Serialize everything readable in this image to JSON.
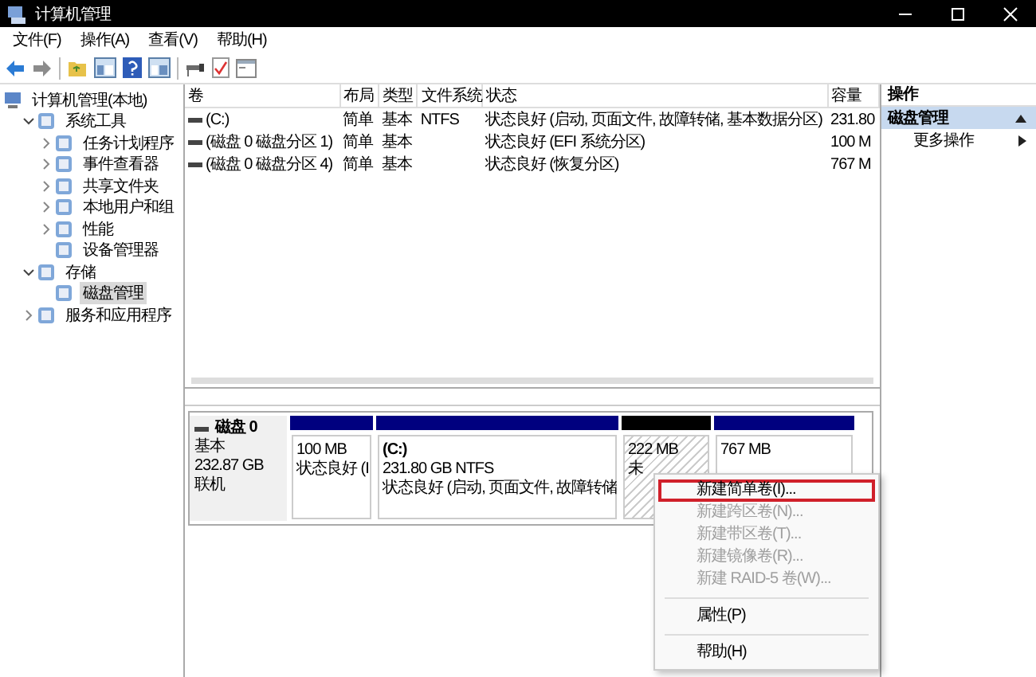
{
  "window": {
    "title": "计算机管理"
  },
  "menu": [
    "文件(F)",
    "操作(A)",
    "查看(V)",
    "帮助(H)"
  ],
  "tree": [
    {
      "label": "计算机管理(本地)",
      "kind": "root",
      "selected": false,
      "children": [
        {
          "label": "系统工具",
          "kind": "node",
          "expanded": true,
          "selected": false,
          "children": [
            {
              "label": "任务计划程序",
              "kind": "node",
              "expanded": false,
              "selected": false
            },
            {
              "label": "事件查看器",
              "kind": "node",
              "expanded": false,
              "selected": false
            },
            {
              "label": "共享文件夹",
              "kind": "node",
              "expanded": false,
              "selected": false
            },
            {
              "label": "本地用户和组",
              "kind": "node",
              "expanded": false,
              "selected": false
            },
            {
              "label": "性能",
              "kind": "node",
              "expanded": false,
              "selected": false
            },
            {
              "label": "设备管理器",
              "kind": "leaf",
              "selected": false
            }
          ]
        },
        {
          "label": "存储",
          "kind": "node",
          "expanded": true,
          "selected": false,
          "children": [
            {
              "label": "磁盘管理",
              "kind": "leaf",
              "selected": true
            }
          ]
        },
        {
          "label": "服务和应用程序",
          "kind": "node",
          "expanded": false,
          "selected": false
        }
      ]
    }
  ],
  "table": {
    "columns": [
      "卷",
      "布局",
      "类型",
      "文件系统",
      "状态",
      "容量"
    ],
    "rows": [
      [
        "(C:)",
        "简单",
        "基本",
        "NTFS",
        "状态良好 (启动, 页面文件, 故障转储, 基本数据分区)",
        "231.80"
      ],
      [
        "(磁盘 0 磁盘分区 1)",
        "简单",
        "基本",
        "",
        "状态良好 (EFI 系统分区)",
        "100 M"
      ],
      [
        "(磁盘 0 磁盘分区 4)",
        "简单",
        "基本",
        "",
        "状态良好 (恢复分区)",
        "767 M"
      ]
    ]
  },
  "disk": {
    "name": "磁盘 0",
    "type": "基本",
    "size": "232.87 GB",
    "state": "联机",
    "partitions": [
      {
        "kind": "primary",
        "size": "100 MB",
        "status": "状态良好 (I"
      },
      {
        "kind": "primary",
        "title": "(C:)",
        "size": "231.80 GB NTFS",
        "status": "状态良好 (启动, 页面文件, 故障转储"
      },
      {
        "kind": "unallocated",
        "size": "222 MB",
        "status": "未"
      },
      {
        "kind": "primary",
        "size": "767 MB"
      }
    ]
  },
  "actions": {
    "title": "操作",
    "items": [
      {
        "label": "磁盘管理",
        "kind": "section",
        "selected": true
      },
      {
        "label": "更多操作",
        "kind": "submenu",
        "selected": false
      }
    ]
  },
  "context_menu": [
    {
      "kind": "item",
      "label": "新建简单卷(I)...",
      "disabled": false,
      "highlighted": true
    },
    {
      "kind": "item",
      "label": "新建跨区卷(N)...",
      "disabled": true,
      "highlighted": false
    },
    {
      "kind": "item",
      "label": "新建带区卷(T)...",
      "disabled": true,
      "highlighted": false
    },
    {
      "kind": "item",
      "label": "新建镜像卷(R)...",
      "disabled": true,
      "highlighted": false
    },
    {
      "kind": "item",
      "label": "新建 RAID-5 卷(W)...",
      "disabled": true,
      "highlighted": false
    },
    {
      "kind": "separator"
    },
    {
      "kind": "item",
      "label": "属性(P)",
      "disabled": false,
      "highlighted": false
    },
    {
      "kind": "separator"
    },
    {
      "kind": "item",
      "label": "帮助(H)",
      "disabled": false,
      "highlighted": false
    }
  ]
}
